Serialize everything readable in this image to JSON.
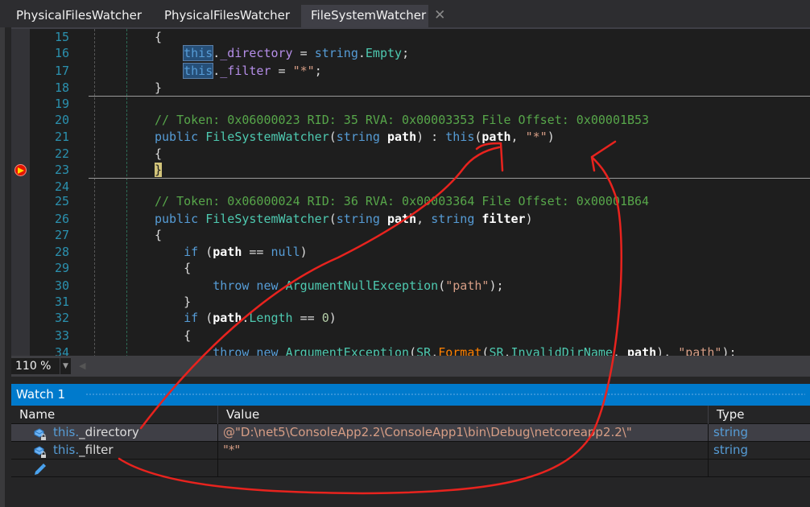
{
  "tabs": [
    {
      "label": "PhysicalFilesWatcher",
      "active": false
    },
    {
      "label": "PhysicalFilesWatcher",
      "active": false
    },
    {
      "label": "FileSystemWatcher",
      "active": true,
      "close_icon": "close-icon"
    }
  ],
  "editor": {
    "lines": [
      {
        "n": "15",
        "tokens": [
          [
            "",
            "{"
          ]
        ]
      },
      {
        "n": "16",
        "tokens": [
          [
            "",
            "    "
          ],
          [
            "kw hl",
            "this"
          ],
          [
            "",
            "."
          ],
          [
            "fld",
            "_directory"
          ],
          [
            "",
            " = "
          ],
          [
            "kw",
            "string"
          ],
          [
            "",
            "."
          ],
          [
            "prop",
            "Empty"
          ],
          [
            "",
            ";"
          ]
        ]
      },
      {
        "n": "17",
        "tokens": [
          [
            "",
            "    "
          ],
          [
            "kw hl",
            "this"
          ],
          [
            "",
            "."
          ],
          [
            "fld",
            "_filter"
          ],
          [
            "",
            " = "
          ],
          [
            "st",
            "\"*\""
          ],
          [
            "",
            ";"
          ]
        ]
      },
      {
        "n": "18",
        "tokens": [
          [
            "",
            "}"
          ]
        ]
      },
      {
        "n": "19",
        "tokens": []
      },
      {
        "n": "20",
        "tokens": [
          [
            "cm",
            "// Token: 0x06000023 RID: 35 RVA: 0x00003353 File Offset: 0x00001B53"
          ]
        ]
      },
      {
        "n": "21",
        "tokens": [
          [
            "kw",
            "public "
          ],
          [
            "ty",
            "FileSystemWatcher"
          ],
          [
            "",
            "("
          ],
          [
            "kw",
            "string "
          ],
          [
            "prm",
            "path"
          ],
          [
            "",
            ") : "
          ],
          [
            "kw",
            "this"
          ],
          [
            "",
            "("
          ],
          [
            "prm",
            "path"
          ],
          [
            "",
            ", "
          ],
          [
            "st",
            "\"*\""
          ],
          [
            "",
            ")"
          ]
        ]
      },
      {
        "n": "22",
        "tokens": [
          [
            "",
            "{"
          ]
        ]
      },
      {
        "n": "23",
        "tokens": [
          [
            "cur",
            "}"
          ]
        ]
      },
      {
        "n": "24",
        "tokens": []
      },
      {
        "n": "25",
        "tokens": [
          [
            "cm",
            "// Token: 0x06000024 RID: 36 RVA: 0x00003364 File Offset: 0x00001B64"
          ]
        ]
      },
      {
        "n": "26",
        "tokens": [
          [
            "kw",
            "public "
          ],
          [
            "ty",
            "FileSystemWatcher"
          ],
          [
            "",
            "("
          ],
          [
            "kw",
            "string "
          ],
          [
            "prm",
            "path"
          ],
          [
            "",
            ", "
          ],
          [
            "kw",
            "string "
          ],
          [
            "prm",
            "filter"
          ],
          [
            "",
            ")"
          ]
        ]
      },
      {
        "n": "27",
        "tokens": [
          [
            "",
            "{"
          ]
        ]
      },
      {
        "n": "28",
        "tokens": [
          [
            "",
            "    "
          ],
          [
            "kw",
            "if "
          ],
          [
            "",
            "("
          ],
          [
            "prm",
            "path"
          ],
          [
            "",
            " == "
          ],
          [
            "kw",
            "null"
          ],
          [
            "",
            ")"
          ]
        ]
      },
      {
        "n": "29",
        "tokens": [
          [
            "",
            "    {"
          ]
        ]
      },
      {
        "n": "30",
        "tokens": [
          [
            "",
            "        "
          ],
          [
            "kw",
            "throw new "
          ],
          [
            "ty",
            "ArgumentNullException"
          ],
          [
            "",
            "("
          ],
          [
            "st",
            "\"path\""
          ],
          [
            "",
            ");"
          ]
        ]
      },
      {
        "n": "31",
        "tokens": [
          [
            "",
            "    }"
          ]
        ]
      },
      {
        "n": "32",
        "tokens": [
          [
            "",
            "    "
          ],
          [
            "kw",
            "if "
          ],
          [
            "",
            "("
          ],
          [
            "prm",
            "path"
          ],
          [
            "",
            "."
          ],
          [
            "prop",
            "Length"
          ],
          [
            "",
            " == "
          ],
          [
            "num",
            "0"
          ],
          [
            "",
            ")"
          ]
        ]
      },
      {
        "n": "33",
        "tokens": [
          [
            "",
            "    {"
          ]
        ]
      },
      {
        "n": "34",
        "tokens": [
          [
            "",
            "        "
          ],
          [
            "kw",
            "throw new "
          ],
          [
            "ty",
            "ArgumentException"
          ],
          [
            "",
            "("
          ],
          [
            "ty",
            "SR"
          ],
          [
            "",
            "."
          ],
          [
            "mth",
            "Format"
          ],
          [
            "",
            "("
          ],
          [
            "ty",
            "SR"
          ],
          [
            "",
            "."
          ],
          [
            "prop",
            "InvalidDirName"
          ],
          [
            "",
            ", "
          ],
          [
            "prm",
            "path"
          ],
          [
            "",
            "), "
          ],
          [
            "st",
            "\"path\""
          ],
          [
            "",
            ");"
          ]
        ]
      }
    ],
    "current_line": "23",
    "breakpoint_icon": "current-statement-breakpoint-icon"
  },
  "zoom": {
    "level": "110 %",
    "dropdown_icon": "chevron-down-icon"
  },
  "watch": {
    "title": "Watch 1",
    "columns": [
      "Name",
      "Value",
      "Type"
    ],
    "rows": [
      {
        "name_prefix": "this.",
        "name": "_directory",
        "value": "@\"D:\\net5\\ConsoleApp2.2\\ConsoleApp1\\bin\\Debug\\netcoreapp2.2\\\"",
        "type": "string",
        "icon": "private-field-icon",
        "selected": true
      },
      {
        "name_prefix": "this.",
        "name": "_filter",
        "value": "\"*\"",
        "type": "string",
        "icon": "private-field-icon",
        "selected": false
      },
      {
        "name_prefix": "",
        "name": "",
        "value": "",
        "type": "",
        "icon": "edit-pencil-icon",
        "selected": false
      }
    ]
  },
  "annotation": {
    "color": "#e8231e"
  }
}
